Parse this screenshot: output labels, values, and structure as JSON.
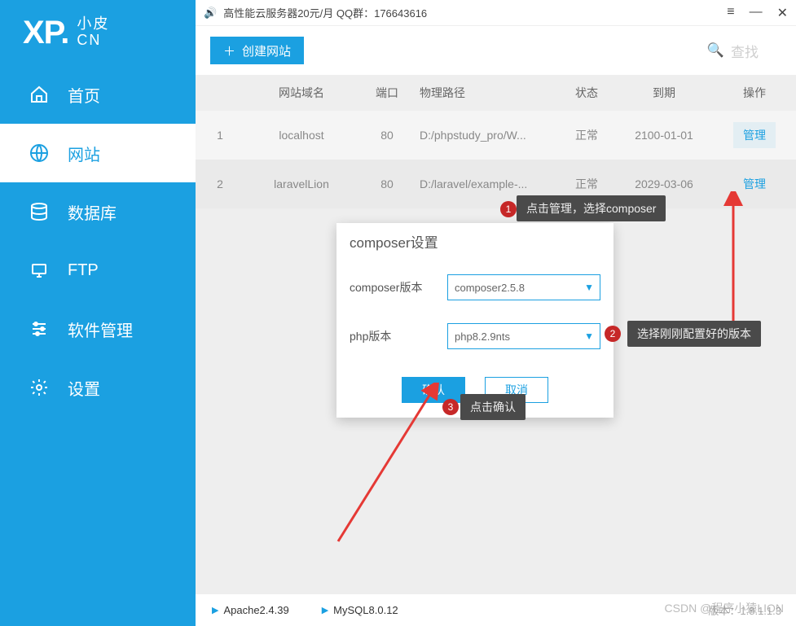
{
  "logo": {
    "xp": "XP.",
    "sub1": "小皮",
    "sub2": "CN"
  },
  "sidebar": {
    "items": [
      {
        "label": "首页",
        "icon": "home"
      },
      {
        "label": "网站",
        "icon": "globe"
      },
      {
        "label": "数据库",
        "icon": "database"
      },
      {
        "label": "FTP",
        "icon": "ftp"
      },
      {
        "label": "软件管理",
        "icon": "sliders"
      },
      {
        "label": "设置",
        "icon": "gear"
      }
    ]
  },
  "titlebar": {
    "promo": "高性能云服务器20元/月  QQ群：176643616"
  },
  "toolbar": {
    "create": "创建网站",
    "search": "查找"
  },
  "table": {
    "headers": {
      "domain": "网站域名",
      "port": "端口",
      "path": "物理路径",
      "status": "状态",
      "exp": "到期",
      "op": "操作"
    },
    "rows": [
      {
        "idx": "1",
        "domain": "localhost",
        "port": "80",
        "path": "D:/phpstudy_pro/W...",
        "status": "正常",
        "exp": "2100-01-01",
        "op": "管理"
      },
      {
        "idx": "2",
        "domain": "laravelLion",
        "port": "80",
        "path": "D:/laravel/example-...",
        "status": "正常",
        "exp": "2029-03-06",
        "op": "管理"
      }
    ]
  },
  "dialog": {
    "title": "composer设置",
    "fields": {
      "composer_label": "composer版本",
      "composer_value": "composer2.5.8",
      "php_label": "php版本",
      "php_value": "php8.2.9nts"
    },
    "confirm": "确认",
    "cancel": "取消"
  },
  "annotations": {
    "a1": "点击管理，选择composer",
    "a2": "选择刚刚配置好的版本",
    "a3": "点击确认"
  },
  "bottom": {
    "apache": "Apache2.4.39",
    "mysql": "MySQL8.0.12",
    "version": "版本：1.8.1.1.3"
  },
  "watermark": "CSDN @程序小猿LION"
}
